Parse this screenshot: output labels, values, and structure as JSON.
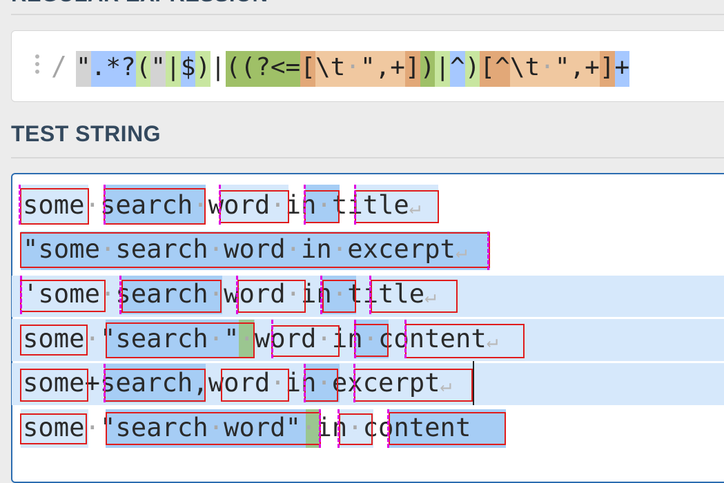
{
  "headers": {
    "regex": "REGULAR EXPRESSION",
    "test": "TEST STRING"
  },
  "regex": {
    "delimiter_open": "/",
    "pattern": "\".*?(\"|$)|((?<=[\\t \",+])|^)[^\\t \",+]+",
    "tokens": [
      {
        "t": "\"",
        "c": "#d3d3d3"
      },
      {
        "t": ".*?",
        "c": "#a6c8ff"
      },
      {
        "t": "(",
        "c": "#c8e6a0"
      },
      {
        "t": "\"",
        "c": "#d3d3d3"
      },
      {
        "t": "|",
        "c": "#c8e6a0"
      },
      {
        "t": "$",
        "c": "#a6c8ff"
      },
      {
        "t": ")",
        "c": "#c8e6a0"
      },
      {
        "t": "|",
        "c": "#ffffff"
      },
      {
        "t": "((?<=",
        "c": "#9fc067"
      },
      {
        "t": "[",
        "c": "#e2a878"
      },
      {
        "t": "\\t",
        "c": "#f0c8a0"
      },
      {
        "t": "·",
        "c": "#f0c8a0"
      },
      {
        "t": "\",+",
        "c": "#f0c8a0"
      },
      {
        "t": "]",
        "c": "#e2a878"
      },
      {
        "t": ")",
        "c": "#9fc067"
      },
      {
        "t": "|",
        "c": "#c8e6a0"
      },
      {
        "t": "^",
        "c": "#a6c8ff"
      },
      {
        "t": ")",
        "c": "#c8e6a0"
      },
      {
        "t": "[^",
        "c": "#e2a878"
      },
      {
        "t": "\\t",
        "c": "#f0c8a0"
      },
      {
        "t": "·",
        "c": "#f0c8a0"
      },
      {
        "t": "\",+",
        "c": "#f0c8a0"
      },
      {
        "t": "]",
        "c": "#e2a878"
      },
      {
        "t": "+",
        "c": "#a6c8ff"
      }
    ]
  },
  "test_lines": [
    "some·search·word·in·title↵",
    "\"some·search·word·in·excerpt↵",
    "'some·search·word·in·title↵",
    "some·\"search·\"·word·in·content↵",
    "some+search,word·in·excerpt↵",
    "some·\"search·word\"·in·content"
  ],
  "colors": {
    "match": "#a6cdf5",
    "match_alt": "#d6e8fb",
    "group": "#9bc690",
    "box": "#e01b1b",
    "boundary": "#e000e0"
  }
}
